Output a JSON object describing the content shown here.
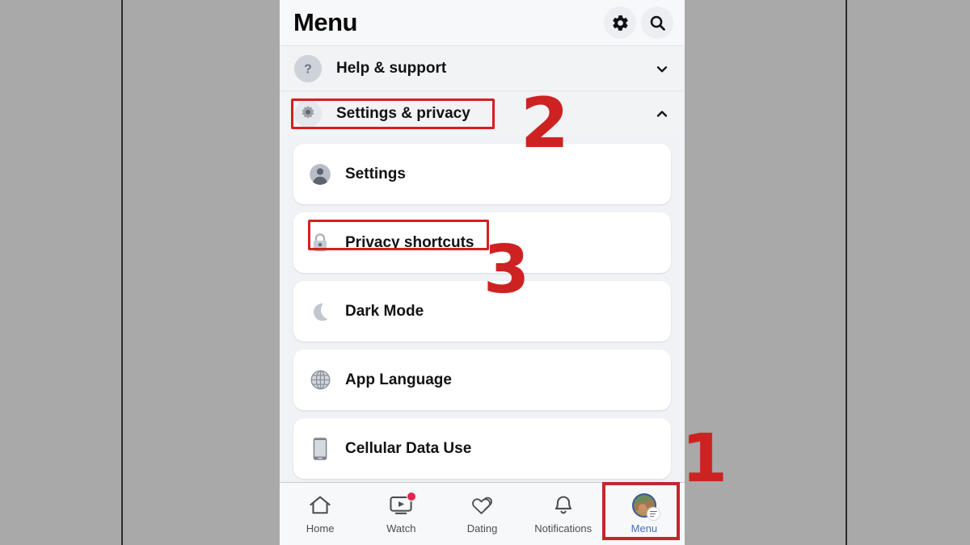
{
  "header": {
    "title": "Menu",
    "gear_icon": "gear-icon",
    "search_icon": "search-icon"
  },
  "menu": {
    "help_support": {
      "label": "Help & support",
      "icon": "question-mark-circle-icon",
      "chevron": "chevron-down-icon"
    },
    "settings_privacy": {
      "label": "Settings & privacy",
      "icon": "gear-flower-icon",
      "chevron": "chevron-up-icon",
      "expanded": true
    },
    "items": [
      {
        "label": "Settings",
        "icon": "person-circle-icon"
      },
      {
        "label": "Privacy shortcuts",
        "icon": "lock-person-icon"
      },
      {
        "label": "Dark Mode",
        "icon": "moon-icon"
      },
      {
        "label": "App Language",
        "icon": "globe-icon"
      },
      {
        "label": "Cellular Data Use",
        "icon": "phone-icon"
      }
    ]
  },
  "tabbar": {
    "tabs": [
      {
        "label": "Home",
        "icon": "home-icon",
        "active": false,
        "badge": false
      },
      {
        "label": "Watch",
        "icon": "watch-tv-play-icon",
        "active": false,
        "badge": true
      },
      {
        "label": "Dating",
        "icon": "double-heart-icon",
        "active": false,
        "badge": false
      },
      {
        "label": "Notifications",
        "icon": "bell-icon",
        "active": false,
        "badge": false
      },
      {
        "label": "Menu",
        "icon": "avatar-menu-icon",
        "active": true,
        "badge": false
      }
    ]
  },
  "annotations": {
    "markers": [
      {
        "id": "1",
        "text": "1",
        "target": "menu-tab"
      },
      {
        "id": "2",
        "text": "2",
        "target": "settings-privacy-row"
      },
      {
        "id": "3",
        "text": "3",
        "target": "privacy-shortcuts-item"
      }
    ],
    "highlight_color": "#cc2222",
    "boxes": [
      "settings-privacy-row",
      "privacy-shortcuts-item",
      "menu-tab"
    ]
  },
  "colors": {
    "accent_red": "#cc2222",
    "box_red": "#c1272d",
    "active_tab_blue": "#4a6fb5",
    "page_bg": "#f0f2f5",
    "card_bg": "#ffffff",
    "frame_gray": "#a9a9a9"
  }
}
